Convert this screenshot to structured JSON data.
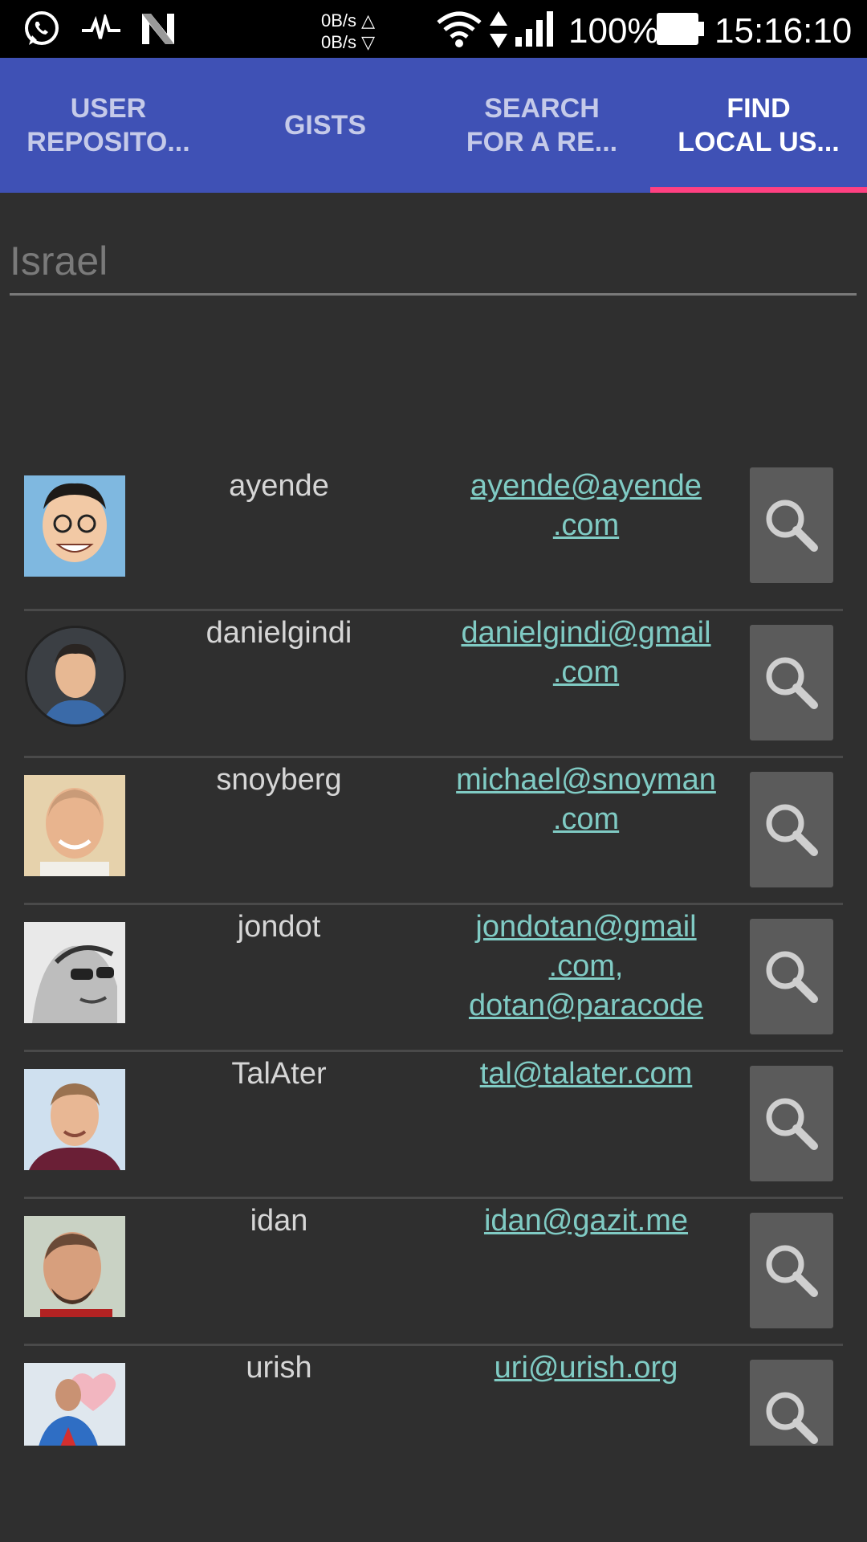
{
  "status_bar": {
    "net_up": "0B/s △",
    "net_down": "0B/s ▽",
    "battery": "100%",
    "time": "15:16:10",
    "icons": [
      "whatsapp-icon",
      "pulse-icon",
      "n-logo-icon",
      "wifi-icon",
      "data-arrows-icon",
      "signal-icon",
      "battery-icon"
    ]
  },
  "tabs": [
    {
      "label": "USER\nREPOSITO..."
    },
    {
      "label": "GISTS"
    },
    {
      "label": "SEARCH\nFOR A RE..."
    },
    {
      "label": "FIND\nLOCAL US..."
    }
  ],
  "active_tab": 3,
  "search": {
    "value": "",
    "placeholder": "Israel"
  },
  "users": [
    {
      "username": "ayende",
      "email": "ayende@ayende\n.com"
    },
    {
      "username": "danielgindi",
      "email": "danielgindi@gmail\n.com"
    },
    {
      "username": "snoyberg",
      "email": "michael@snoyman\n.com"
    },
    {
      "username": "jondot",
      "email": "jondotan@gmail\n.com,\ndotan@paracode\n.com"
    },
    {
      "username": "TalAter",
      "email": "tal@talater.com"
    },
    {
      "username": "idan",
      "email": "idan@gazit.me"
    },
    {
      "username": "urish",
      "email": "uri@urish.org"
    }
  ],
  "colors": {
    "tab_bar": "#3f51b5",
    "tab_indicator": "#ff4081",
    "link": "#80cbc4",
    "background": "#2f2f2f"
  }
}
